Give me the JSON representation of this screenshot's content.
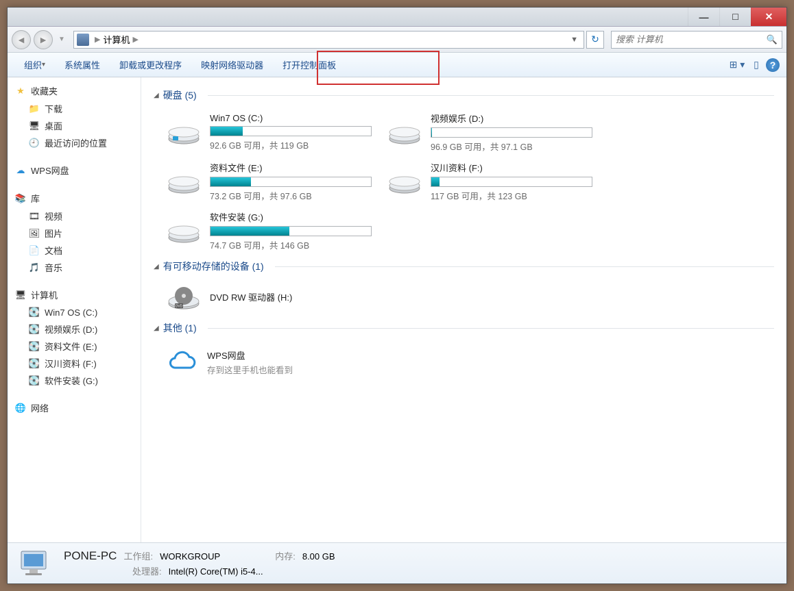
{
  "nav": {
    "location": "计算机",
    "search_placeholder": "搜索 计算机"
  },
  "toolbar": {
    "organize": "组织",
    "properties": "系统属性",
    "uninstall": "卸载或更改程序",
    "mapdrive": "映射网络驱动器",
    "controlpanel": "打开控制面板"
  },
  "sidebar": {
    "favorites": "收藏夹",
    "downloads": "下载",
    "desktop": "桌面",
    "recent": "最近访问的位置",
    "wps": "WPS网盘",
    "libraries": "库",
    "video": "视频",
    "pictures": "图片",
    "documents": "文档",
    "music": "音乐",
    "computer": "计算机",
    "d1": "Win7 OS (C:)",
    "d2": "视频娱乐 (D:)",
    "d3": "资料文件 (E:)",
    "d4": "汉川资料 (F:)",
    "d5": "软件安装 (G:)",
    "network": "网络"
  },
  "groups": {
    "hdd": "硬盘 (5)",
    "removable": "有可移动存储的设备 (1)",
    "other": "其他 (1)"
  },
  "drives": [
    {
      "name": "Win7 OS (C:)",
      "stat": "92.6 GB 可用，共 119 GB",
      "fill": 20
    },
    {
      "name": "视频娱乐 (D:)",
      "stat": "96.9 GB 可用，共 97.1 GB",
      "fill": 0.5
    },
    {
      "name": "资料文件 (E:)",
      "stat": "73.2 GB 可用，共 97.6 GB",
      "fill": 25
    },
    {
      "name": "汉川资料 (F:)",
      "stat": "117 GB 可用，共 123 GB",
      "fill": 5
    },
    {
      "name": "软件安装 (G:)",
      "stat": "74.7 GB 可用，共 146 GB",
      "fill": 49
    }
  ],
  "dvd": {
    "name": "DVD RW 驱动器 (H:)"
  },
  "otheritem": {
    "name": "WPS网盘",
    "sub": "存到这里手机也能看到"
  },
  "status": {
    "pcname": "PONE-PC",
    "wglabel": "工作组:",
    "workgroup": "WORKGROUP",
    "memlabel": "内存:",
    "mem": "8.00 GB",
    "cpulabel": "处理器:",
    "cpu": "Intel(R) Core(TM) i5-4..."
  }
}
